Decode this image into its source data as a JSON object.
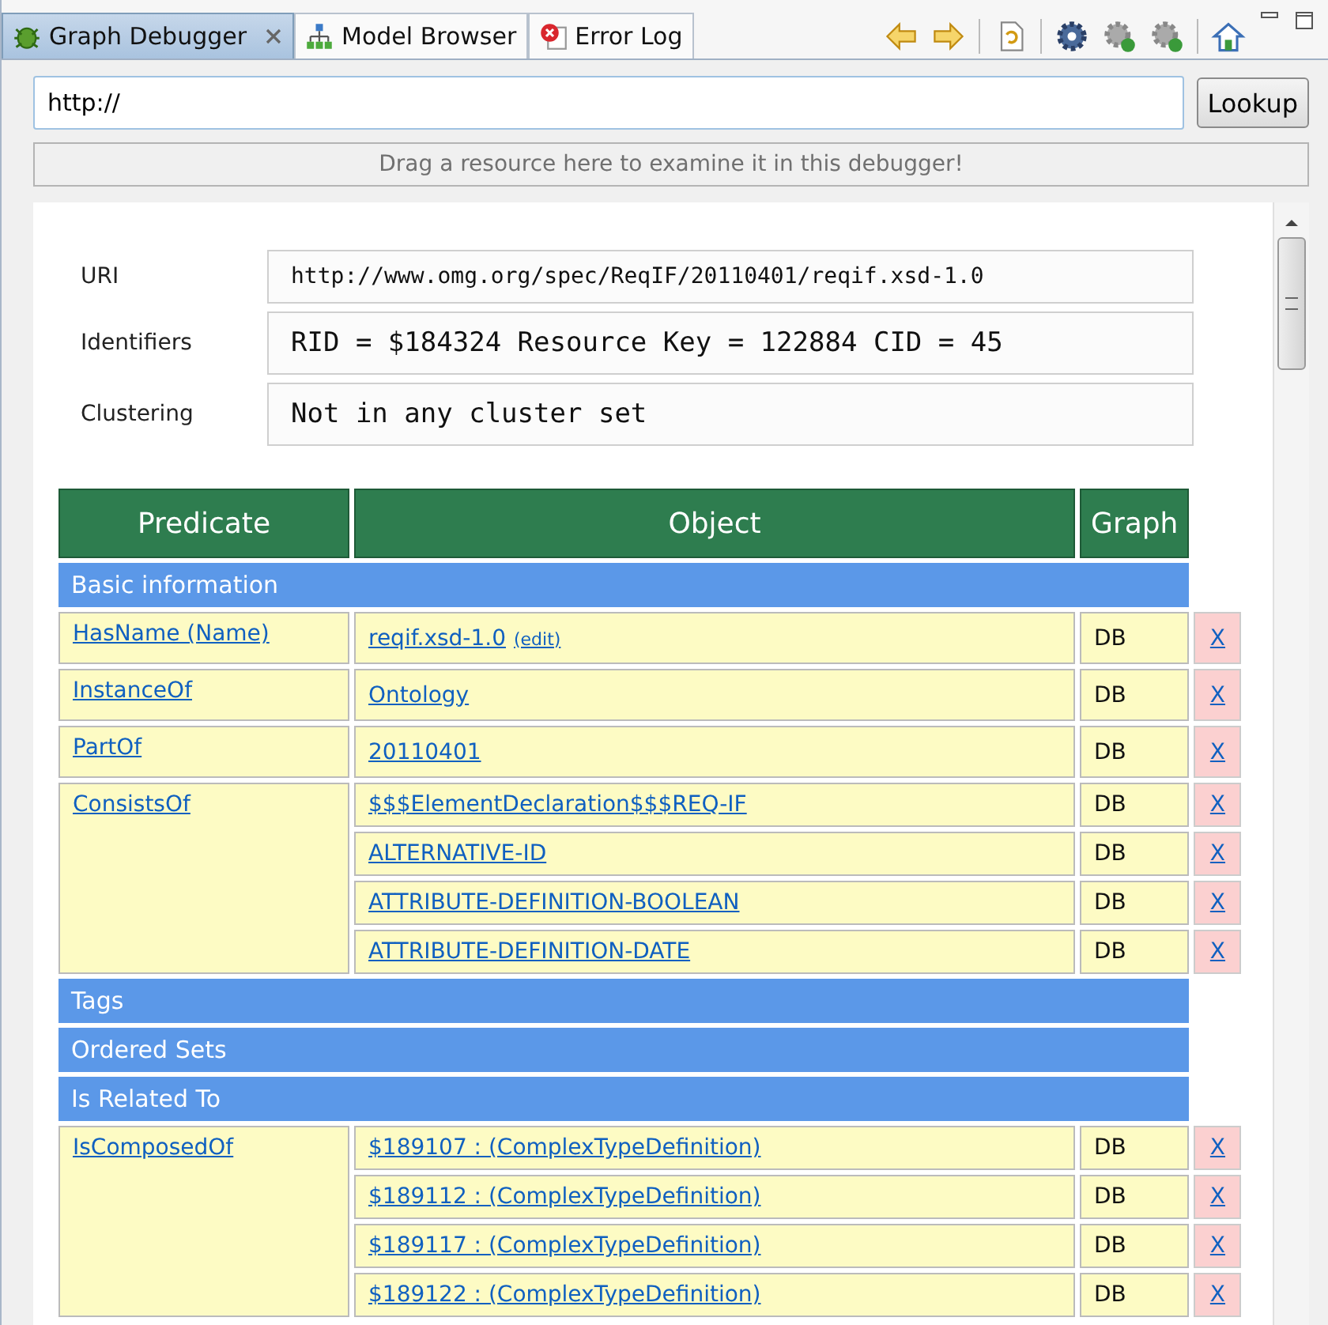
{
  "tabs": [
    {
      "label": "Graph Debugger",
      "selected": true,
      "closable": true,
      "kind": "bug"
    },
    {
      "label": "Model Browser",
      "selected": false,
      "closable": false,
      "kind": "tree"
    },
    {
      "label": "Error Log",
      "selected": false,
      "closable": false,
      "kind": "error"
    }
  ],
  "url_field": {
    "value": "http://"
  },
  "lookup_button": {
    "label": "Lookup"
  },
  "drop_hint": "Drag a resource here to examine it in this debugger!",
  "info": [
    {
      "label": "URI",
      "value": "http://www.omg.org/spec/ReqIF/20110401/reqif.xsd-1.0",
      "large": false
    },
    {
      "label": "Identifiers",
      "value": "RID = $184324 Resource Key = 122884 CID = 45",
      "large": true
    },
    {
      "label": "Clustering",
      "value": "Not in any cluster set",
      "large": true
    }
  ],
  "table": {
    "columns": [
      "Predicate",
      "Object",
      "Graph"
    ],
    "sections": [
      {
        "title": "Basic information",
        "groups": [
          {
            "predicate": "HasName (Name)",
            "objects": [
              {
                "text": "reqif.xsd-1.0",
                "edit": "(edit)",
                "graph": "DB",
                "remove": "X"
              }
            ]
          },
          {
            "predicate": "InstanceOf",
            "objects": [
              {
                "text": "Ontology",
                "graph": "DB",
                "remove": "X"
              }
            ]
          },
          {
            "predicate": "PartOf",
            "objects": [
              {
                "text": "20110401",
                "graph": "DB",
                "remove": "X"
              }
            ]
          },
          {
            "predicate": "ConsistsOf",
            "objects": [
              {
                "text": "$$$ElementDeclaration$$$REQ-IF",
                "graph": "DB",
                "remove": "X"
              },
              {
                "text": "ALTERNATIVE-ID",
                "graph": "DB",
                "remove": "X"
              },
              {
                "text": "ATTRIBUTE-DEFINITION-BOOLEAN",
                "graph": "DB",
                "remove": "X"
              },
              {
                "text": "ATTRIBUTE-DEFINITION-DATE",
                "graph": "DB",
                "remove": "X"
              }
            ]
          }
        ]
      },
      {
        "title": "Tags"
      },
      {
        "title": "Ordered Sets"
      },
      {
        "title": "Is Related To",
        "groups": [
          {
            "predicate": "IsComposedOf",
            "objects": [
              {
                "text": "$189107 : (ComplexTypeDefinition)",
                "graph": "DB",
                "remove": "X"
              },
              {
                "text": "$189112 : (ComplexTypeDefinition)",
                "graph": "DB",
                "remove": "X"
              },
              {
                "text": "$189117 : (ComplexTypeDefinition)",
                "graph": "DB",
                "remove": "X"
              },
              {
                "text": "$189122 : (ComplexTypeDefinition)",
                "graph": "DB",
                "remove": "X"
              }
            ]
          }
        ]
      }
    ]
  }
}
